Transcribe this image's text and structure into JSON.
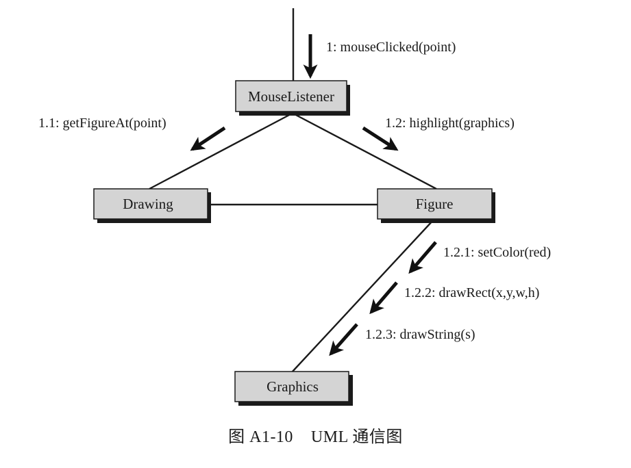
{
  "diagram": {
    "type": "UML communication diagram",
    "colors": {
      "box_fill": "#d4d4d4",
      "box_border": "#1a1a1a",
      "shadow": "#1a1a1a",
      "line": "#1a1a1a",
      "text": "#1a1a1a"
    },
    "nodes": [
      {
        "id": "mouselistener",
        "label": "MouseListener"
      },
      {
        "id": "drawing",
        "label": "Drawing"
      },
      {
        "id": "figure",
        "label": "Figure"
      },
      {
        "id": "graphics",
        "label": "Graphics"
      }
    ],
    "links": [
      {
        "from": "actor",
        "to": "mouselistener"
      },
      {
        "from": "mouselistener",
        "to": "drawing"
      },
      {
        "from": "mouselistener",
        "to": "figure"
      },
      {
        "from": "drawing",
        "to": "figure"
      },
      {
        "from": "figure",
        "to": "graphics"
      }
    ],
    "messages": [
      {
        "seq": "1",
        "label": "1: mouseClicked(point)",
        "to": "mouselistener"
      },
      {
        "seq": "1.1",
        "label": "1.1: getFigureAt(point)",
        "to": "drawing"
      },
      {
        "seq": "1.2",
        "label": "1.2: highlight(graphics)",
        "to": "figure"
      },
      {
        "seq": "1.2.1",
        "label": "1.2.1: setColor(red)",
        "to": "graphics"
      },
      {
        "seq": "1.2.2",
        "label": "1.2.2: drawRect(x,y,w,h)",
        "to": "graphics"
      },
      {
        "seq": "1.2.3",
        "label": "1.2.3: drawString(s)",
        "to": "graphics"
      }
    ]
  },
  "caption": {
    "figure_number": "图 A1-10",
    "title": "UML 通信图",
    "full": "图 A1-10    UML 通信图"
  }
}
